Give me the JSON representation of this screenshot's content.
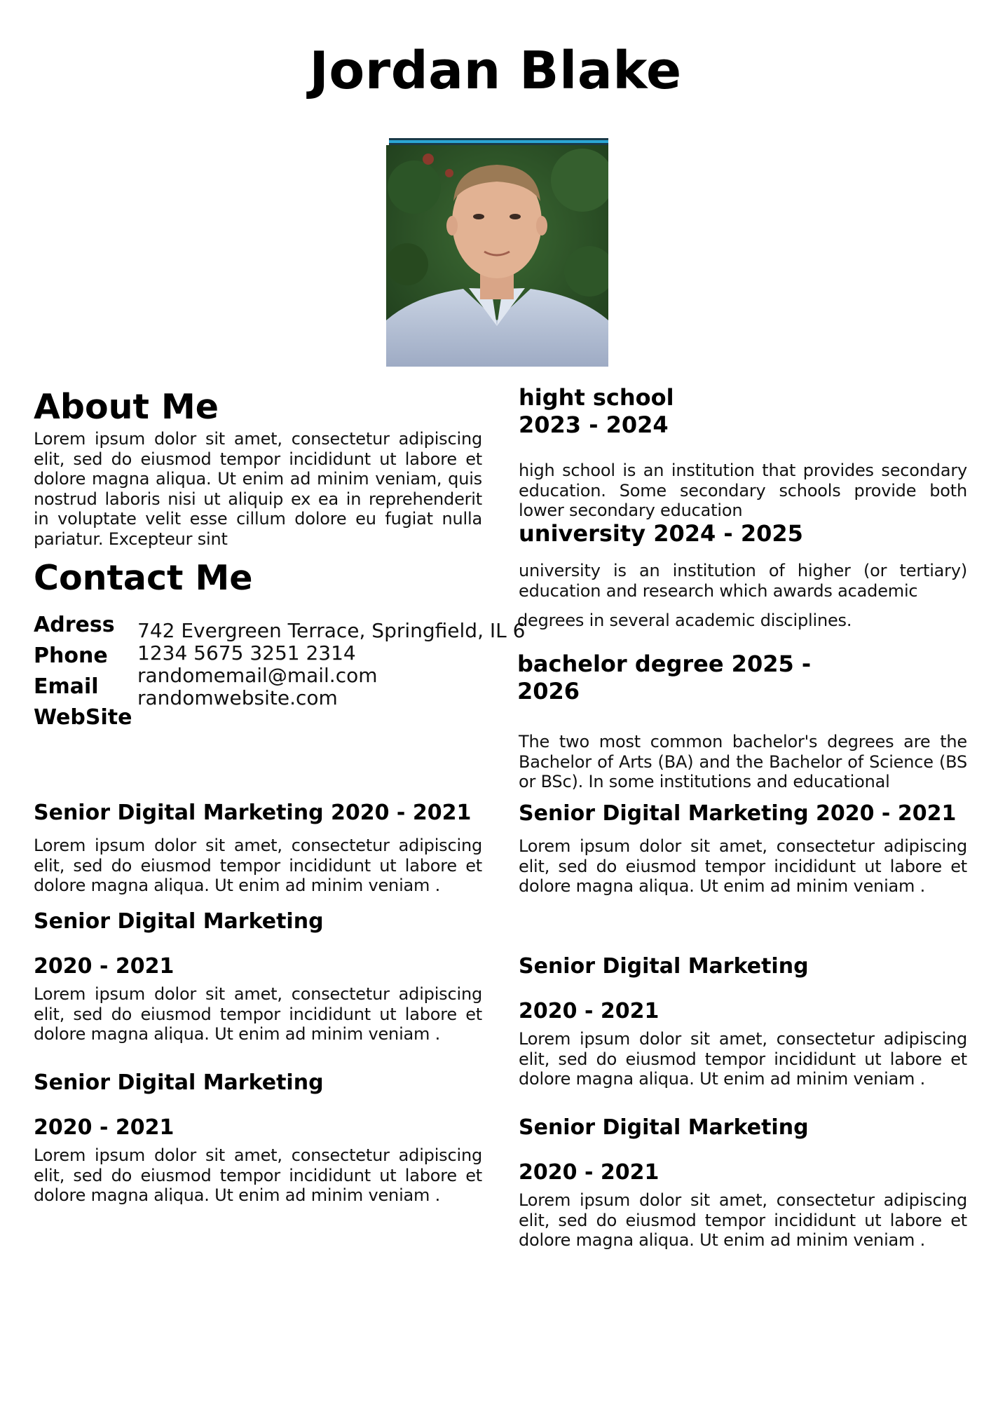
{
  "name": "Jordan Blake",
  "about": {
    "heading": "About Me",
    "text": "Lorem ipsum dolor sit amet, consectetur adipiscing elit, sed do eiusmod tempor incididunt ut labore et dolore magna aliqua. Ut enim ad minim veniam, quis nostrud laboris nisi ut aliquip ex ea in reprehenderit in voluptate velit esse cillum dolore eu fugiat nulla pariatur. Excepteur sint"
  },
  "contact": {
    "heading": "Contact Me",
    "labels": [
      "Adress",
      "Phone",
      "Email",
      "WebSite"
    ],
    "values": [
      "742 Evergreen Terrace, Springfield, IL 6",
      "1234 5675 3251 2314",
      "randomemail@mail.com",
      "randomwebsite.com"
    ]
  },
  "education": [
    {
      "title_line1": "hight school",
      "title_line2": "2023 - 2024",
      "text": "high school is an institution that provides secondary education. Some secondary schools provide both lower secondary education"
    },
    {
      "title_line1": "university 2024 - 2025",
      "text": "university is an institution of higher (or tertiary) education and research which awards academic",
      "text_extra": "degrees in several academic disciplines."
    },
    {
      "title_line1": "bachelor degree 2025 -",
      "title_line2": "2026",
      "text": "The two most common bachelor's degrees are the Bachelor of Arts (BA) and the Bachelor of Science (BS or BSc). In some institutions and educational"
    }
  ],
  "experience_left": [
    {
      "title": "Senior Digital Marketing 2020 - 2021",
      "text": "Lorem ipsum dolor sit amet, consectetur adipiscing elit, sed do eiusmod tempor incididunt ut labore et dolore magna aliqua. Ut enim ad minim veniam ."
    },
    {
      "title": "Senior Digital Marketing",
      "years": "2020 - 2021",
      "text": "Lorem ipsum dolor sit amet, consectetur adipiscing elit, sed do eiusmod tempor incididunt ut labore et dolore magna aliqua. Ut enim ad minim veniam ."
    },
    {
      "title": "Senior Digital Marketing",
      "years": "2020 - 2021",
      "text": "Lorem ipsum dolor sit amet, consectetur adipiscing elit, sed do eiusmod tempor incididunt ut labore et dolore magna aliqua. Ut enim ad minim veniam ."
    }
  ],
  "experience_right": [
    {
      "title": "Senior Digital Marketing 2020 - 2021",
      "text": "Lorem ipsum dolor sit amet, consectetur adipiscing elit, sed do eiusmod tempor incididunt ut labore et dolore magna aliqua. Ut enim ad minim veniam ."
    },
    {
      "title": "Senior Digital Marketing",
      "years": "2020 - 2021",
      "text": "Lorem ipsum dolor sit amet, consectetur adipiscing elit, sed do eiusmod tempor incididunt ut labore et dolore magna aliqua. Ut enim ad minim veniam ."
    },
    {
      "title": "Senior Digital Marketing",
      "years": "2020 - 2021",
      "text": "Lorem ipsum dolor sit amet, consectetur adipiscing elit, sed do eiusmod tempor incididunt ut labore et dolore magna aliqua. Ut enim ad minim veniam ."
    }
  ]
}
